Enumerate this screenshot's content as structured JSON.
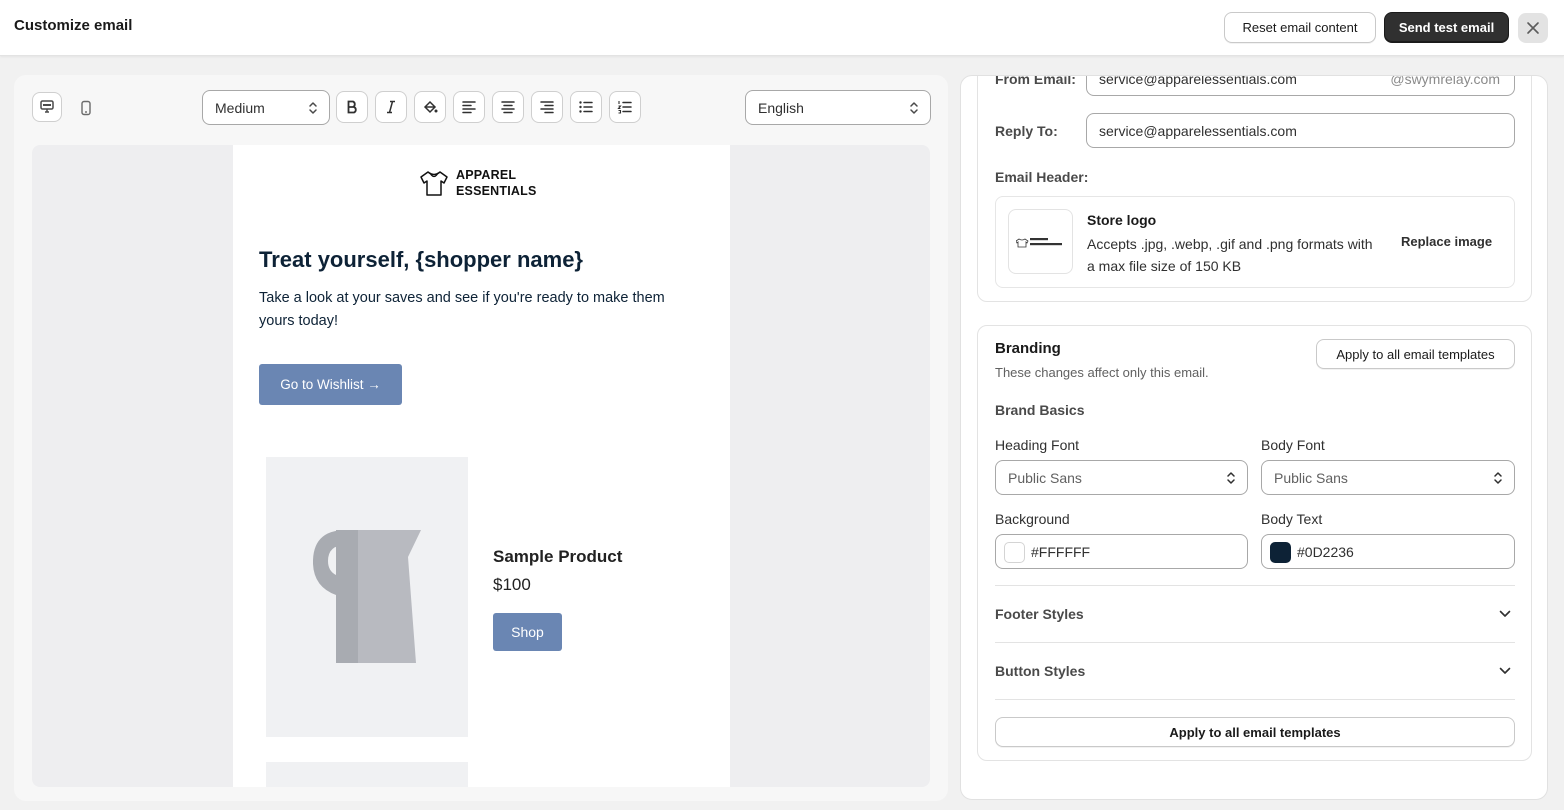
{
  "topbar": {
    "title": "Customize email",
    "reset_label": "Reset email content",
    "send_test_label": "Send test email"
  },
  "toolbar": {
    "size_select": "Medium",
    "language_select": "English"
  },
  "email_preview": {
    "logo_line1": "APPAREL",
    "logo_line2": "ESSENTIALS",
    "heading": "Treat yourself, {shopper name}",
    "body": "Take a look at your saves and see if you're ready to make them yours today!",
    "wishlist_button": "Go to Wishlist →",
    "product_name": "Sample Product",
    "product_price": "$100",
    "shop_button": "Shop"
  },
  "sender": {
    "from_label": "From Email:",
    "from_value": "service@apparelessentials.com",
    "from_suffix": "@swymrelay.com",
    "reply_label": "Reply To:",
    "reply_value": "service@apparelessentials.com",
    "header_label": "Email Header:",
    "logo_title": "Store logo",
    "logo_desc": "Accepts .jpg, .webp, .gif and .png formats with a max file size of 150 KB",
    "replace_label": "Replace image"
  },
  "branding": {
    "title": "Branding",
    "subtitle": "These changes affect only this email.",
    "apply_top_label": "Apply to all email templates",
    "basics_label": "Brand Basics",
    "heading_font_label": "Heading Font",
    "heading_font_value": "Public Sans",
    "body_font_label": "Body Font",
    "body_font_value": "Public Sans",
    "background_label": "Background",
    "background_value": "#FFFFFF",
    "body_text_label": "Body Text",
    "body_text_value": "#0D2236",
    "footer_styles": "Footer Styles",
    "button_styles": "Button Styles",
    "apply_bottom_label": "Apply to all email templates"
  },
  "colors": {
    "accent_button": "#6a86b3",
    "primary_dark": "#303030",
    "body_text": "#0D2236",
    "background": "#FFFFFF"
  },
  "icons": [
    "desktop-icon",
    "mobile-icon",
    "bold-icon",
    "italic-icon",
    "fill-color-icon",
    "align-left-icon",
    "align-center-icon",
    "align-right-icon",
    "bullet-list-icon",
    "numbered-list-icon",
    "chevron-updown-icon",
    "close-icon",
    "chevron-down-icon",
    "shirt-logo-icon"
  ]
}
